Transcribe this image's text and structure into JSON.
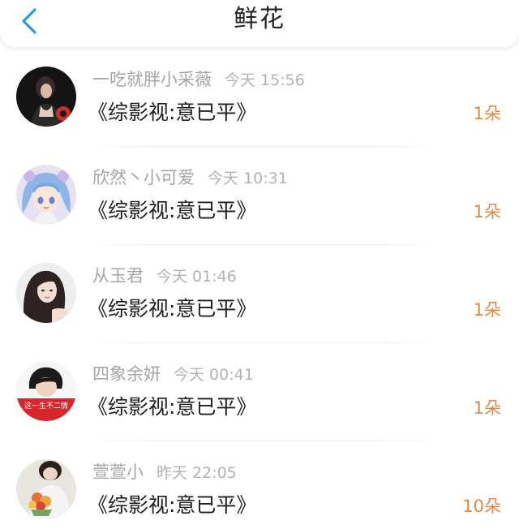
{
  "header": {
    "title": "鲜花",
    "back_icon": "chevron-left-icon",
    "accent_color": "#2b9bd8"
  },
  "colors": {
    "name": "#a5a5a5",
    "count": "#e3873e",
    "book": "#1e1e1e"
  },
  "items": [
    {
      "name": "一吃就胖小采薇",
      "time": "今天 15:56",
      "book": "《综影视:意已平》",
      "count": "1朵"
    },
    {
      "name": "欣然丶小可爱",
      "time": "今天 10:31",
      "book": "《综影视:意已平》",
      "count": "1朵"
    },
    {
      "name": "从玉君",
      "time": "今天 01:46",
      "book": "《综影视:意已平》",
      "count": "1朵"
    },
    {
      "name": "四象余妍",
      "time": "今天 00:41",
      "book": "《综影视:意已平》",
      "count": "1朵"
    },
    {
      "name": "萱萱小",
      "time": "昨天 22:05",
      "book": "《综影视:意已平》",
      "count": "10朵"
    }
  ],
  "avatar_texts": {
    "row4": "这一生不二情"
  }
}
